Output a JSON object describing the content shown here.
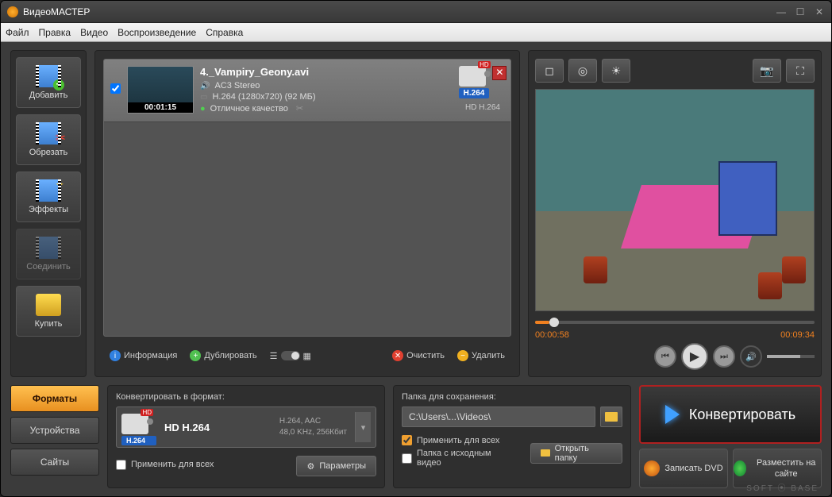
{
  "app_title": "ВидеоМАСТЕР",
  "menu": {
    "file": "Файл",
    "edit": "Правка",
    "video": "Видео",
    "playback": "Воспроизведение",
    "help": "Справка"
  },
  "sidebar": {
    "add": "Добавить",
    "cut": "Обрезать",
    "effects": "Эффекты",
    "join": "Соединить",
    "buy": "Купить"
  },
  "file": {
    "name": "4._Vampiry_Geony.avi",
    "audio": "AC3 Stereo",
    "video_spec": "H.264 (1280x720) (92 МБ)",
    "quality": "Отличное качество",
    "duration": "00:01:15",
    "format_label": "H.264",
    "format_sub": "HD H.264"
  },
  "list_tools": {
    "info": "Информация",
    "duplicate": "Дублировать",
    "clear": "Очистить",
    "delete": "Удалить"
  },
  "preview": {
    "time_current": "00:00:58",
    "time_total": "00:09:34"
  },
  "tabs": {
    "formats": "Форматы",
    "devices": "Устройства",
    "sites": "Сайты"
  },
  "format_panel": {
    "header": "Конвертировать в формат:",
    "name": "HD H.264",
    "codec": "H.264",
    "spec1": "H.264, AAC",
    "spec2": "48,0 KHz, 256Кбит",
    "apply_all": "Применить для всех",
    "params": "Параметры"
  },
  "save_panel": {
    "header": "Папка для сохранения:",
    "path": "C:\\Users\\...\\Videos\\",
    "apply_all": "Применить для всех",
    "source_folder": "Папка с исходным видео",
    "open_folder": "Открыть папку"
  },
  "actions": {
    "convert": "Конвертировать",
    "burn_dvd": "Записать DVD",
    "publish": "Разместить на сайте"
  },
  "watermark": "SOFT ⦿ BASE"
}
